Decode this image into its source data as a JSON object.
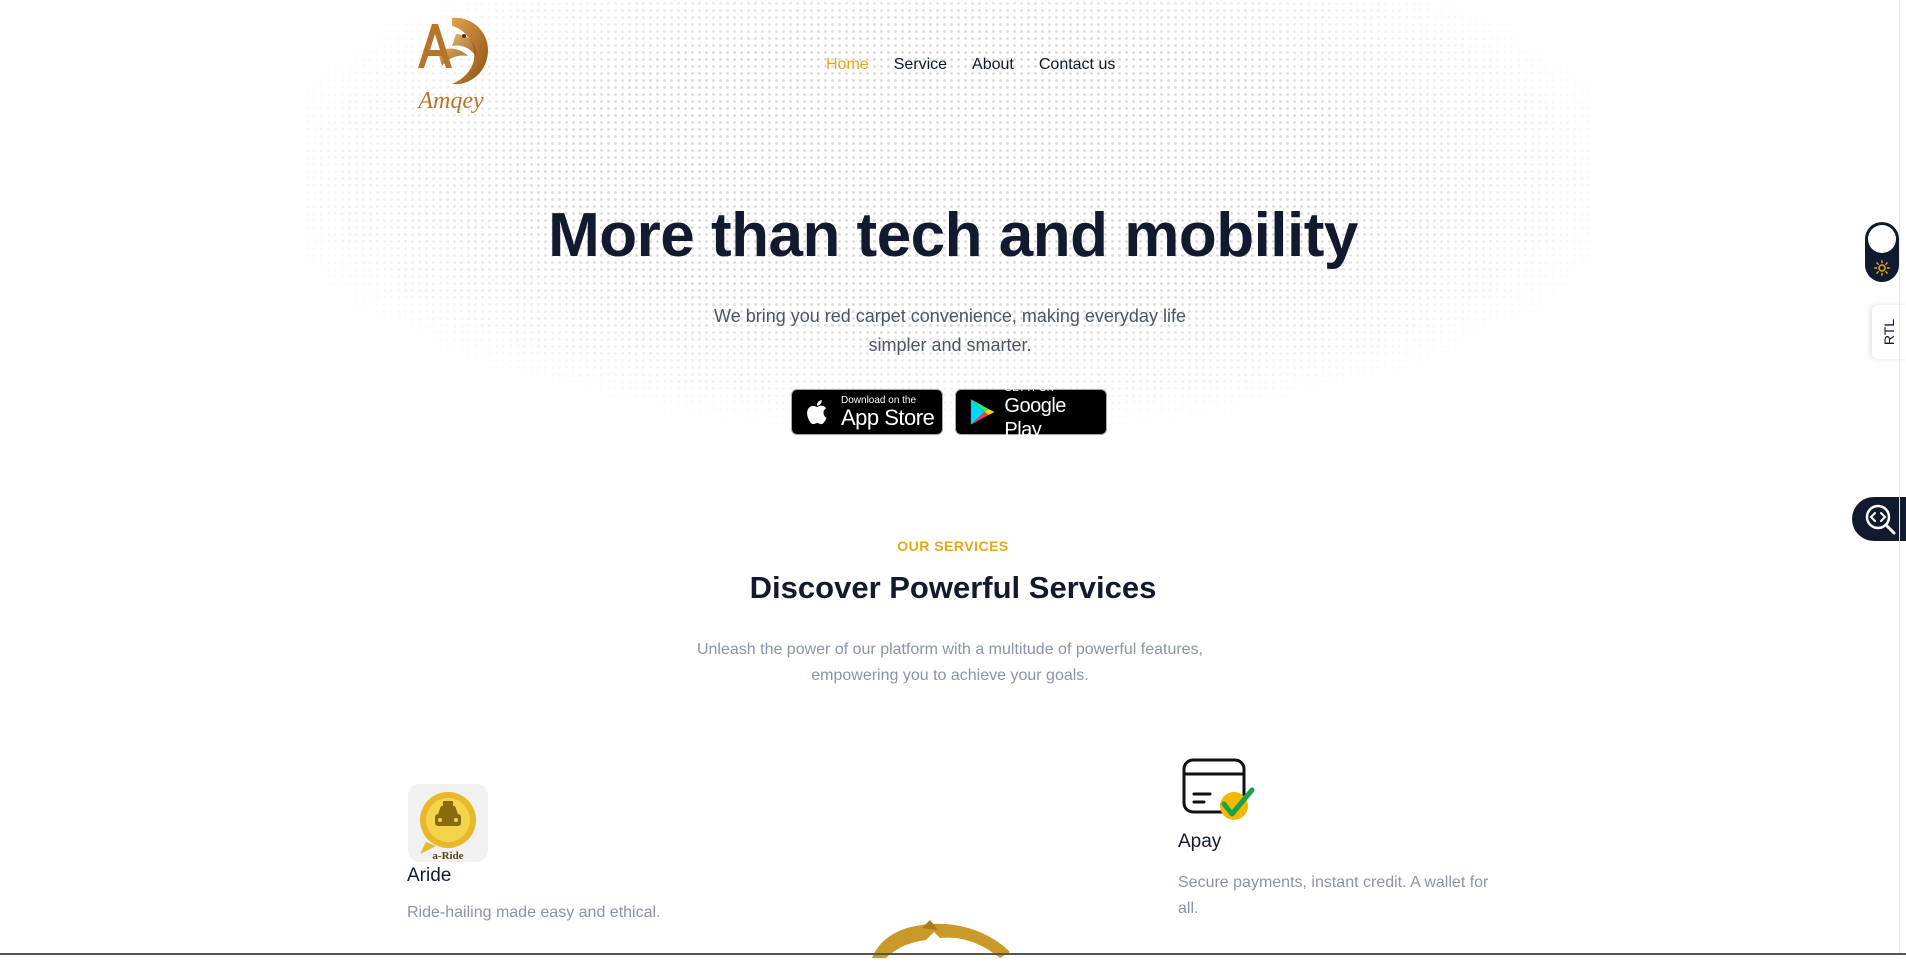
{
  "brand": {
    "name": "Amqey",
    "accent": "#e6a817",
    "logo_color": "#b8752a"
  },
  "nav": {
    "items": [
      {
        "label": "Home",
        "active": true
      },
      {
        "label": "Service",
        "active": false
      },
      {
        "label": "About",
        "active": false
      },
      {
        "label": "Contact us",
        "active": false
      }
    ]
  },
  "hero": {
    "title": "More than tech and mobility",
    "subtitle": "We bring you red carpet convenience, making everyday life simpler and smarter.",
    "app_store": {
      "small": "Download on the",
      "big": "App Store",
      "icon": "apple-icon"
    },
    "google_play": {
      "small": "GET IT ON",
      "big": "Google Play",
      "icon": "google-play-icon"
    }
  },
  "services": {
    "eyebrow": "OUR SERVICES",
    "title": "Discover Powerful Services",
    "subtitle": "Unleash the power of our platform with a multitude of powerful features, empowering you to achieve your goals.",
    "items": [
      {
        "name": "Aride",
        "description": "Ride-hailing made easy and ethical.",
        "icon": "aride-taxi-icon",
        "icon_caption": "a-Ride"
      },
      {
        "name": "Apay",
        "description": "Secure payments, instant credit. A wallet for all.",
        "icon": "card-check-icon"
      }
    ]
  },
  "side_controls": {
    "theme_toggle_icon": "sun-icon",
    "rtl_label": "RTL",
    "inspect_icon": "code-search-icon"
  }
}
